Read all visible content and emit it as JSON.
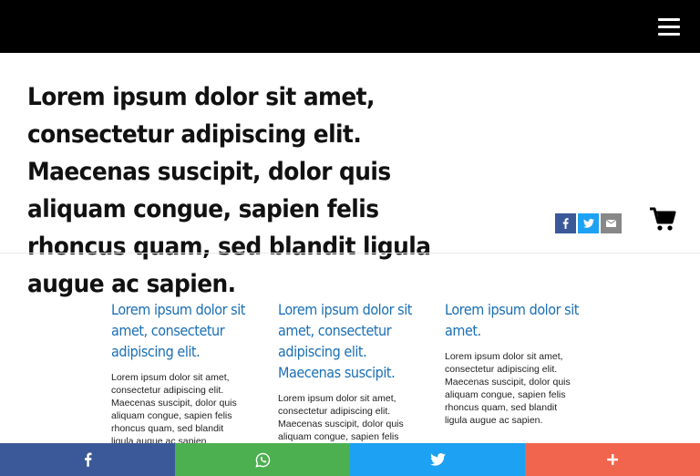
{
  "header": {
    "menu_icon": "hamburger-menu-icon"
  },
  "article": {
    "headline": "Lorem ipsum dolor sit amet, consectetur adipiscing elit. Maecenas suscipit, dolor quis aliquam congue, sapien felis rhoncus quam, sed blandit ligula augue ac sapien."
  },
  "share_small": {
    "icons": [
      "facebook-icon",
      "twitter-icon",
      "email-icon"
    ]
  },
  "cart": {
    "icon": "shopping-cart-icon"
  },
  "columns": [
    {
      "title": "Lorem ipsum dolor sit amet, consectetur adipiscing elit.",
      "body": "Lorem ipsum dolor sit amet, consectetur adipiscing elit. Maecenas suscipit, dolor quis aliquam congue, sapien felis rhoncus quam, sed blandit ligula augue ac sapien."
    },
    {
      "title": "Lorem ipsum dolor sit amet, consectetur adipiscing elit. Maecenas suscipit.",
      "body": "Lorem ipsum dolor sit amet, consectetur adipiscing elit. Maecenas suscipit, dolor quis aliquam congue, sapien felis rhoncus quam, sed blandit ligula augue ac sapien."
    },
    {
      "title": "Lorem ipsum dolor sit amet.",
      "body": "Lorem ipsum dolor sit amet, consectetur adipiscing elit. Maecenas suscipit, dolor quis aliquam congue, sapien felis rhoncus quam, sed blandit ligula augue ac sapien."
    }
  ],
  "share_bar": {
    "buttons": [
      {
        "icon": "facebook-icon",
        "color": "#3b5998"
      },
      {
        "icon": "whatsapp-icon",
        "color": "#4caf50"
      },
      {
        "icon": "twitter-icon",
        "color": "#1da1f2"
      },
      {
        "icon": "plus-icon",
        "color": "#f1654e"
      }
    ]
  }
}
